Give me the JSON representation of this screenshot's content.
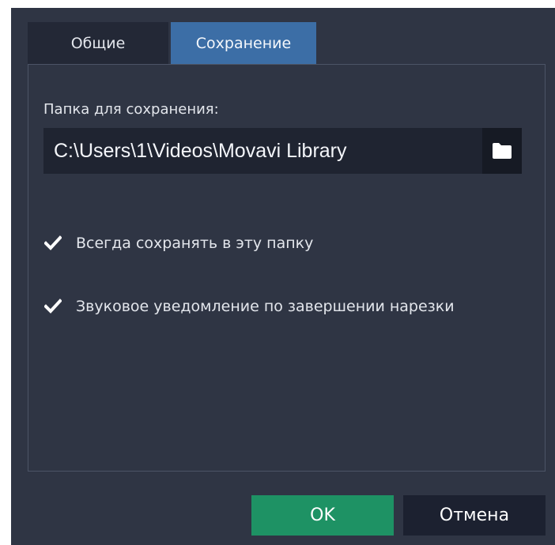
{
  "tabs": [
    {
      "label": "Общие",
      "active": false
    },
    {
      "label": "Сохранение",
      "active": true
    }
  ],
  "save_folder": {
    "label": "Папка для сохранения:",
    "value": "C:\\Users\\1\\Videos\\Movavi Library",
    "browse_icon": "folder-icon"
  },
  "options": [
    {
      "label": "Всегда сохранять в эту папку",
      "checked": true
    },
    {
      "label": "Звуковое уведомление по завершении нарезки",
      "checked": true
    }
  ],
  "buttons": {
    "ok_label": "OK",
    "cancel_label": "Отмена"
  },
  "colors": {
    "background": "#2f3544",
    "active_tab": "#3c6ea6",
    "ok_button": "#1e9264",
    "field": "#1f2431"
  }
}
